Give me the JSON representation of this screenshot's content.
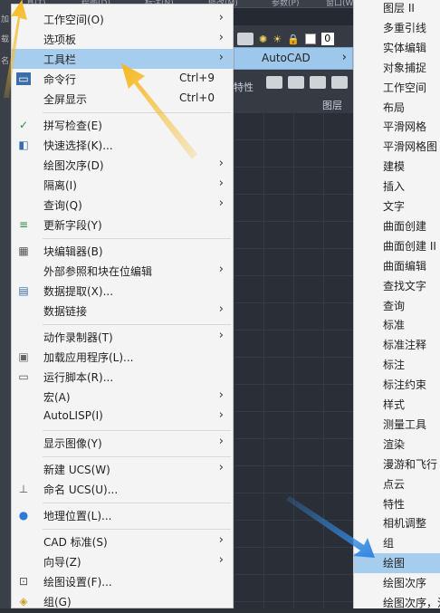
{
  "menu": {
    "items": [
      {
        "label": "工作空间(O)",
        "shortcut": "",
        "arrow": true,
        "icon": ""
      },
      {
        "label": "选项板",
        "shortcut": "",
        "arrow": true,
        "icon": ""
      },
      {
        "label": "工具栏",
        "shortcut": "",
        "arrow": true,
        "icon": "",
        "highlight": true
      },
      {
        "label": "命令行",
        "shortcut": "Ctrl+9",
        "arrow": false,
        "icon": "command-line-icon"
      },
      {
        "label": "全屏显示",
        "shortcut": "Ctrl+0",
        "arrow": false,
        "icon": ""
      },
      {
        "label": "拼写检查(E)",
        "shortcut": "",
        "arrow": false,
        "icon": "spell-check-icon"
      },
      {
        "label": "快速选择(K)...",
        "shortcut": "",
        "arrow": false,
        "icon": "quick-select-icon"
      },
      {
        "label": "绘图次序(D)",
        "shortcut": "",
        "arrow": true,
        "icon": ""
      },
      {
        "label": "隔离(I)",
        "shortcut": "",
        "arrow": true,
        "icon": ""
      },
      {
        "label": "查询(Q)",
        "shortcut": "",
        "arrow": true,
        "icon": ""
      },
      {
        "label": "更新字段(Y)",
        "shortcut": "",
        "arrow": false,
        "icon": "update-field-icon"
      },
      {
        "label": "块编辑器(B)",
        "shortcut": "",
        "arrow": false,
        "icon": "block-editor-icon"
      },
      {
        "label": "外部参照和块在位编辑",
        "shortcut": "",
        "arrow": true,
        "icon": ""
      },
      {
        "label": "数据提取(X)...",
        "shortcut": "",
        "arrow": false,
        "icon": "data-extract-icon"
      },
      {
        "label": "数据链接",
        "shortcut": "",
        "arrow": true,
        "icon": ""
      },
      {
        "label": "动作录制器(T)",
        "shortcut": "",
        "arrow": true,
        "icon": ""
      },
      {
        "label": "加载应用程序(L)...",
        "shortcut": "",
        "arrow": false,
        "icon": "load-app-icon"
      },
      {
        "label": "运行脚本(R)...",
        "shortcut": "",
        "arrow": false,
        "icon": "run-script-icon"
      },
      {
        "label": "宏(A)",
        "shortcut": "",
        "arrow": true,
        "icon": ""
      },
      {
        "label": "AutoLISP(I)",
        "shortcut": "",
        "arrow": true,
        "icon": ""
      },
      {
        "label": "显示图像(Y)",
        "shortcut": "",
        "arrow": true,
        "icon": ""
      },
      {
        "label": "新建 UCS(W)",
        "shortcut": "",
        "arrow": true,
        "icon": ""
      },
      {
        "label": "命名 UCS(U)...",
        "shortcut": "",
        "arrow": false,
        "icon": "named-ucs-icon"
      },
      {
        "label": "地理位置(L)...",
        "shortcut": "",
        "arrow": false,
        "icon": "globe-icon"
      },
      {
        "label": "CAD 标准(S)",
        "shortcut": "",
        "arrow": true,
        "icon": ""
      },
      {
        "label": "向导(Z)",
        "shortcut": "",
        "arrow": true,
        "icon": ""
      },
      {
        "label": "绘图设置(F)...",
        "shortcut": "",
        "arrow": false,
        "icon": "drafting-settings-icon"
      },
      {
        "label": "组(G)",
        "shortcut": "",
        "arrow": false,
        "icon": "group-icon"
      }
    ]
  },
  "submenu": {
    "label": "AutoCAD"
  },
  "toolbars": {
    "items": [
      "图层 II",
      "多重引线",
      "实体编辑",
      "对象捕捉",
      "工作空间",
      "布局",
      "平滑网格",
      "平滑网格图",
      "建模",
      "插入",
      "文字",
      "曲面创建",
      "曲面创建 II",
      "曲面编辑",
      "查找文字",
      "查询",
      "标准",
      "标准注释",
      "标注",
      "标注约束",
      "样式",
      "测量工具",
      "渲染",
      "漫游和飞行",
      "点云",
      "特性",
      "相机调整",
      "组",
      "绘图",
      "绘图次序",
      "绘图次序，注"
    ],
    "selected_index": 28
  },
  "ribbon": {
    "panel_label": "图层",
    "props_label": "特性",
    "layer_number": "0"
  },
  "topbar": {
    "items": [
      "工具(T)",
      "绘图(D)",
      "标注(N)",
      "修改(M)",
      "参数(P)",
      "窗口(W)"
    ]
  },
  "leftstrip": {
    "items": [
      "加",
      "载",
      "名"
    ]
  }
}
